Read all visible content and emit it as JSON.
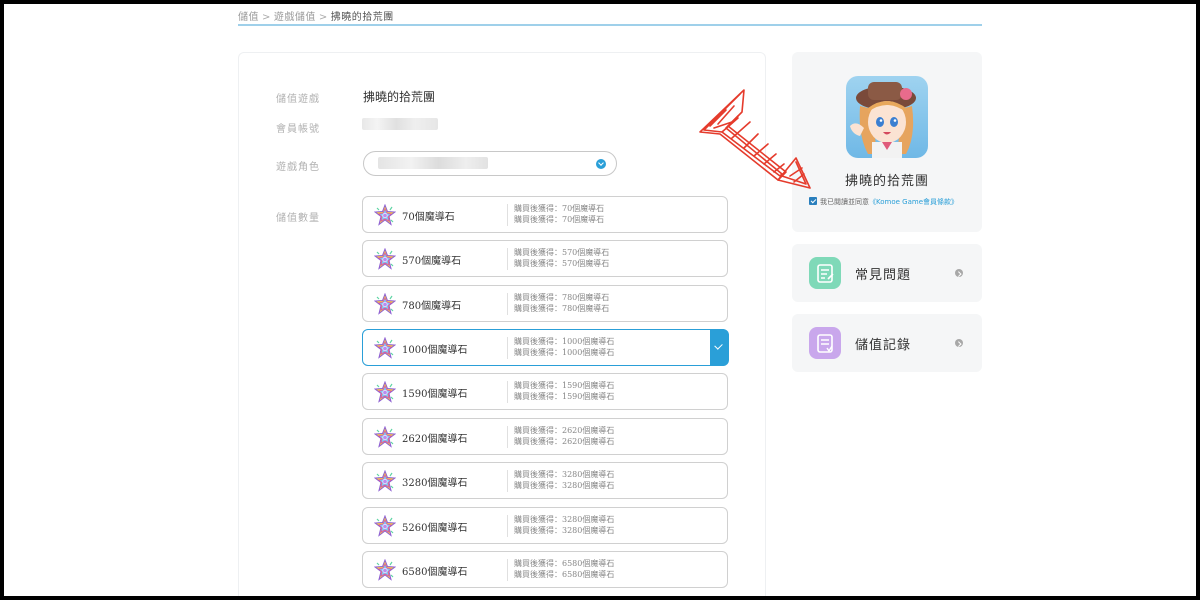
{
  "breadcrumb": {
    "home": "儲值",
    "parent": "遊戲儲值",
    "current": "拂曉的拾荒團",
    "separator": ">"
  },
  "form": {
    "labels": {
      "game": "儲值遊戲",
      "account": "會員帳號",
      "role": "遊戲角色",
      "amount": "儲值數量"
    },
    "game_value": "拂曉的拾荒團",
    "account_value": "",
    "role_value": ""
  },
  "packages": [
    {
      "name": "70個魔導石",
      "line1": "購買後獲得：70個魔導石",
      "line2": "購買後獲得：70個魔導石",
      "selected": false
    },
    {
      "name": "570個魔導石",
      "line1": "購買後獲得：570個魔導石",
      "line2": "購買後獲得：570個魔導石",
      "selected": false
    },
    {
      "name": "780個魔導石",
      "line1": "購買後獲得：780個魔導石",
      "line2": "購買後獲得：780個魔導石",
      "selected": false
    },
    {
      "name": "1000個魔導石",
      "line1": "購買後獲得：1000個魔導石",
      "line2": "購買後獲得：1000個魔導石",
      "selected": true
    },
    {
      "name": "1590個魔導石",
      "line1": "購買後獲得：1590個魔導石",
      "line2": "購買後獲得：1590個魔導石",
      "selected": false
    },
    {
      "name": "2620個魔導石",
      "line1": "購買後獲得：2620個魔導石",
      "line2": "購買後獲得：2620個魔導石",
      "selected": false
    },
    {
      "name": "3280個魔導石",
      "line1": "購買後獲得：3280個魔導石",
      "line2": "購買後獲得：3280個魔導石",
      "selected": false
    },
    {
      "name": "5260個魔導石",
      "line1": "購買後獲得：3280個魔導石",
      "line2": "購買後獲得：3280個魔導石",
      "selected": false
    },
    {
      "name": "6580個魔導石",
      "line1": "購買後獲得：6580個魔導石",
      "line2": "購買後獲得：6580個魔導石",
      "selected": false
    }
  ],
  "sidebar": {
    "game_name": "拂曉的拾荒團",
    "agree_text": "我已閱讀並同意",
    "agree_link": "《Komoe Game會員條款》",
    "agree_checked": true,
    "menu": [
      {
        "label": "常見問題",
        "icon": "faq-icon",
        "color": "#7fd9b8"
      },
      {
        "label": "儲值記錄",
        "icon": "record-icon",
        "color": "#c9a7ec"
      }
    ]
  },
  "colors": {
    "accent": "#2a9fd8",
    "annotation": "#e53b2c"
  }
}
